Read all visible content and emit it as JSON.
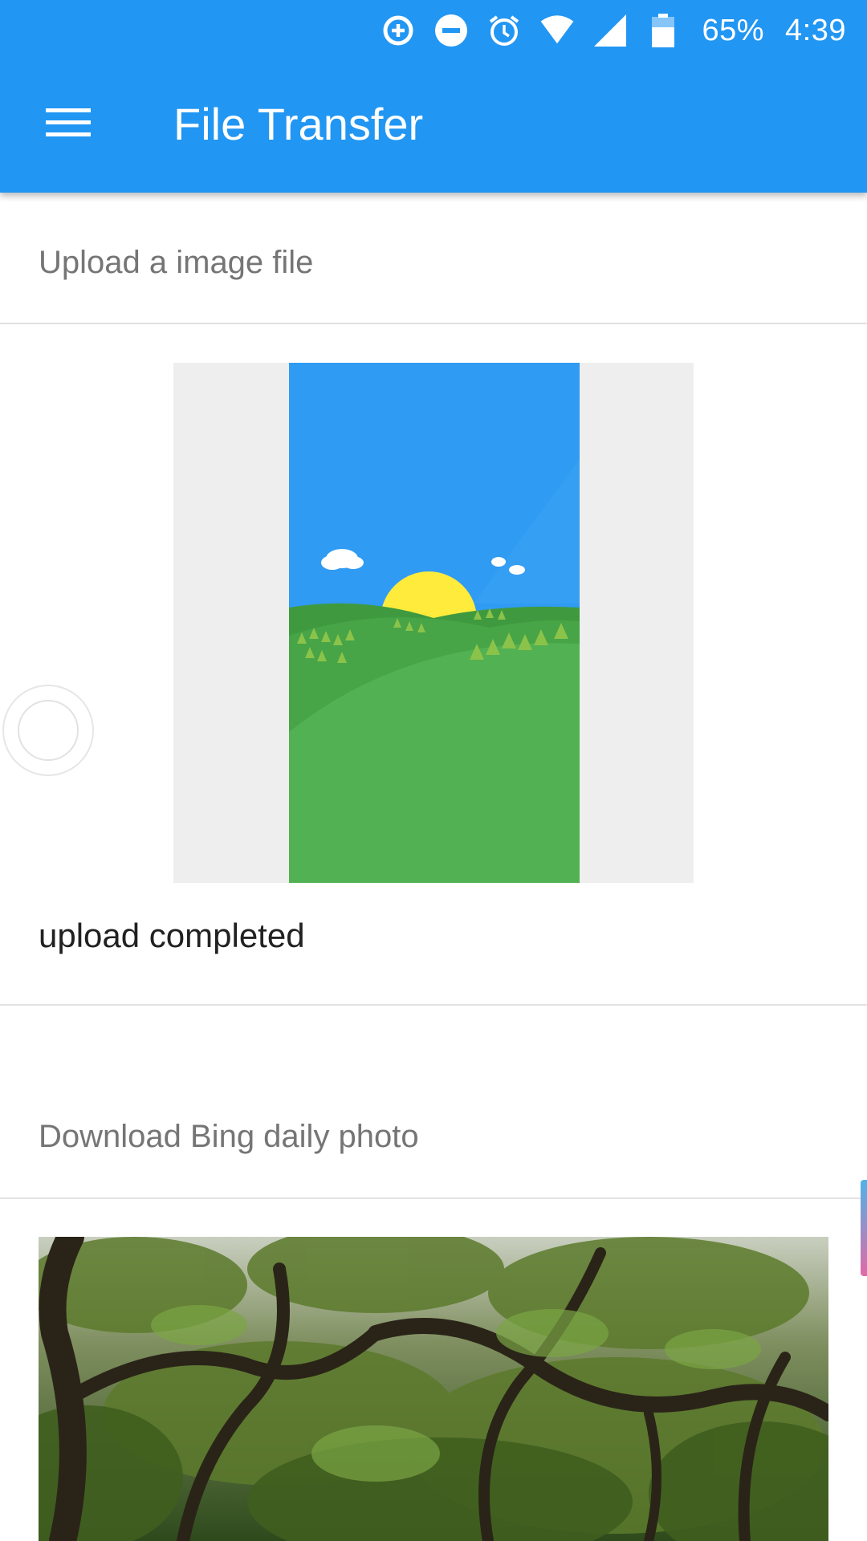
{
  "status_bar": {
    "icons": [
      "data-saver-icon",
      "do-not-disturb-icon",
      "alarm-icon",
      "wifi-icon",
      "cell-signal-icon",
      "battery-icon"
    ],
    "battery": "65%",
    "time": "4:39"
  },
  "toolbar": {
    "menu_icon": "hamburger-menu-icon",
    "title": "File Transfer"
  },
  "upload_section": {
    "header": "Upload a image file",
    "status": "upload completed"
  },
  "download_section": {
    "header": "Download Bing daily photo"
  },
  "colors": {
    "primary": "#2196F3",
    "sky": "#2F9BF3",
    "grass": "#52B152",
    "sun": "#FFEB3B",
    "header_text": "#757575",
    "divider": "#E2E2E2"
  }
}
